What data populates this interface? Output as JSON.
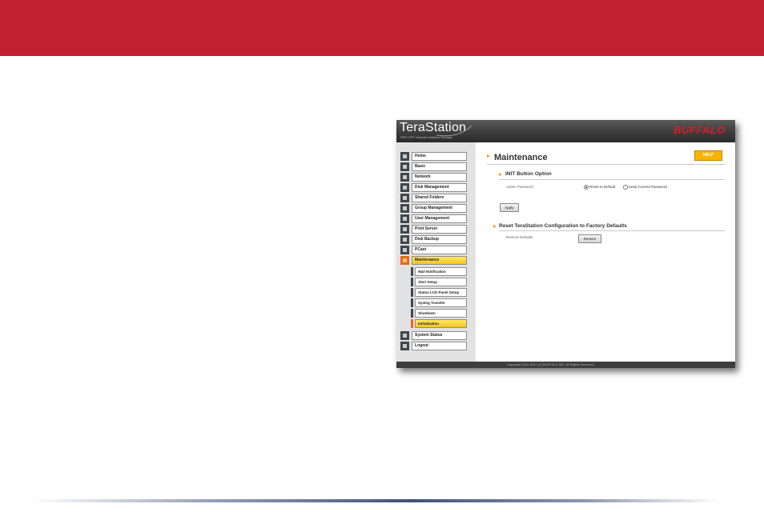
{
  "app": {
    "logo": "TeraStation",
    "logo_sub": "PRO GPT network Attached Storage",
    "brand": "BUFFALO",
    "accent_color": "#c1202e"
  },
  "sidebar": {
    "items": [
      {
        "label": "Home",
        "icon": "home-icon"
      },
      {
        "label": "Basic",
        "icon": "basic-settings-icon"
      },
      {
        "label": "Network",
        "icon": "network-icon"
      },
      {
        "label": "Disk Management",
        "icon": "disk-icon"
      },
      {
        "label": "Shared Folders",
        "icon": "folder-icon"
      },
      {
        "label": "Group Management",
        "icon": "group-icon"
      },
      {
        "label": "User Management",
        "icon": "user-icon"
      },
      {
        "label": "Print Server",
        "icon": "printer-icon"
      },
      {
        "label": "Disk Backup",
        "icon": "backup-icon"
      },
      {
        "label": "PCast",
        "icon": "pcast-icon"
      },
      {
        "label": "Maintenance",
        "icon": "maintenance-icon",
        "active": true
      }
    ],
    "sub_items": [
      {
        "label": "Mail Notification"
      },
      {
        "label": "Alert Setup"
      },
      {
        "label": "Status LCD Panel Setup"
      },
      {
        "label": "Syslog Transfer"
      },
      {
        "label": "Shutdown"
      },
      {
        "label": "Initialization",
        "active": true
      }
    ],
    "bottom_items": [
      {
        "label": "System Status",
        "icon": "status-icon"
      },
      {
        "label": "Logout",
        "icon": "logout-icon"
      }
    ]
  },
  "main": {
    "title": "Maintenance",
    "help_label": "HELP",
    "section1": {
      "title": "INIT Button Option",
      "field_label": "Admin Password",
      "option_reset": "Reset to Default",
      "option_keep": "Keep Current Password",
      "selected": "Reset to Default",
      "apply_label": "Apply"
    },
    "section2": {
      "title": "Reset TeraStation Configuration to Factory Defaults",
      "field_label": "Restore Defaults",
      "restore_label": "Restore"
    }
  },
  "footer": {
    "copyright": "Copyright 2002-2007 (C) BUFFALO INC. All Rights Reserved."
  }
}
